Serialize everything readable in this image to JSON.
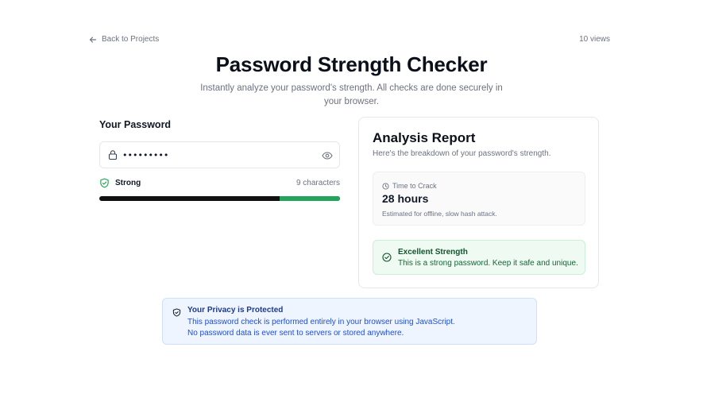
{
  "header": {
    "back_label": "Back to Projects",
    "views": "10 views",
    "title": "Password Strength Checker",
    "subtitle": "Instantly analyze your password's strength. All checks are done securely in your browser."
  },
  "password": {
    "heading": "Your Password",
    "value": "•••••••••",
    "strength": "Strong",
    "char_count": "9 characters",
    "strength_fraction": 0.25,
    "meter_color": "#22a55a"
  },
  "report": {
    "title": "Analysis Report",
    "subtitle": "Here's the breakdown of your password's strength.",
    "crack_label": "Time to Crack",
    "crack_value": "28 hours",
    "crack_note": "Estimated for offline, slow hash attack.",
    "strength_title": "Excellent Strength",
    "strength_text": "This is a strong password. Keep it safe and unique."
  },
  "privacy": {
    "title": "Your Privacy is Protected",
    "line1": "This password check is performed entirely in your browser using JavaScript.",
    "line2": "No password data is ever sent to servers or stored anywhere."
  },
  "icons": {
    "back": "arrow-left-icon",
    "lock": "lock-icon",
    "eye": "eye-icon",
    "shield": "shield-check-icon",
    "clock": "clock-icon",
    "check": "check-circle-icon",
    "privacy": "shield-icon"
  }
}
